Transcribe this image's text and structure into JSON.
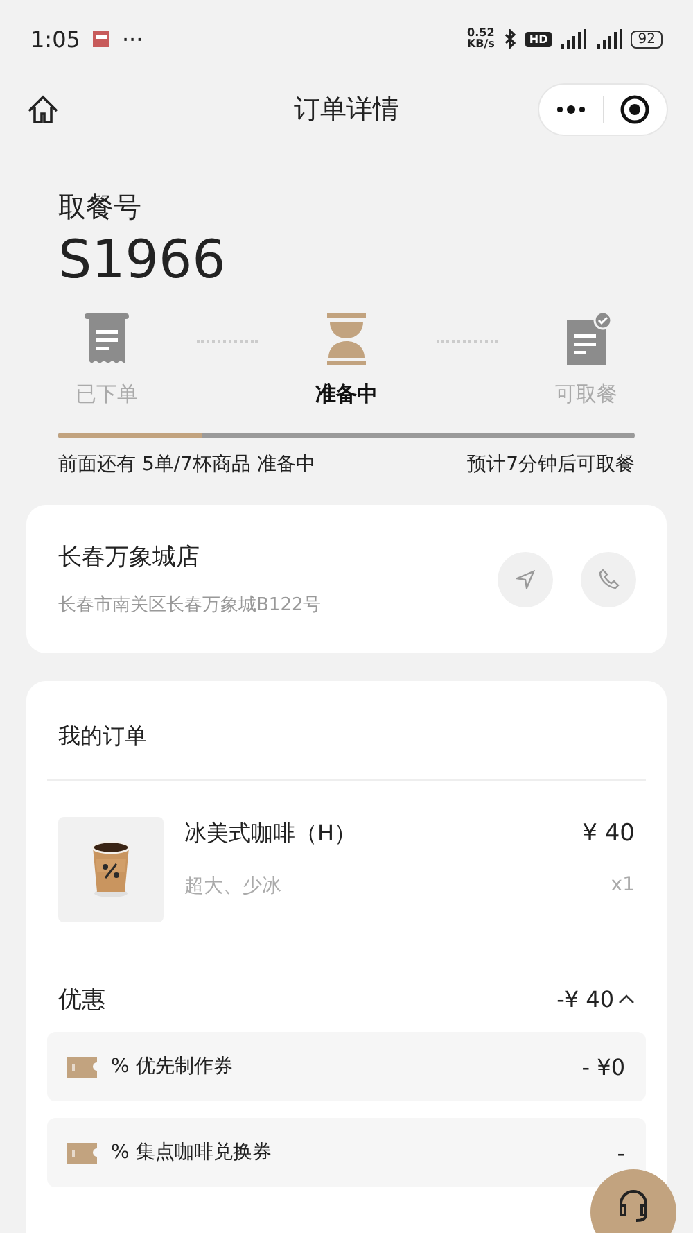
{
  "status_bar": {
    "time": "1:05",
    "dots": "···",
    "speed_value": "0.52",
    "speed_unit": "KB/s",
    "hd": "HD",
    "battery": "92"
  },
  "nav": {
    "title": "订单详情"
  },
  "pickup": {
    "label": "取餐号",
    "number": "S1966",
    "steps": [
      {
        "label": "已下单",
        "kind": "receipt",
        "selected": false
      },
      {
        "label": "准备中",
        "kind": "hourglass",
        "selected": true
      },
      {
        "label": "可取餐",
        "kind": "ready",
        "selected": false
      }
    ],
    "progress": {
      "level": 0.25
    },
    "queue_text": "前面还有 5单/7杯商品 准备中",
    "eta_text": "预计7分钟后可取餐"
  },
  "store": {
    "name": "长春万象城店",
    "address": "长春市南关区长春万象城B122号"
  },
  "order": {
    "title": "我的订单",
    "items": [
      {
        "name": "冰美式咖啡（H）",
        "options": "超大、少冰",
        "price": "¥ 40",
        "quantity": "x1"
      }
    ],
    "discount": {
      "label": "优惠",
      "amount": "-¥ 40",
      "expanded": true
    },
    "coupons": [
      {
        "name": "% 优先制作券",
        "amount": "- ¥0"
      },
      {
        "name": "% 集点咖啡兑换券",
        "amount": "-"
      }
    ]
  }
}
